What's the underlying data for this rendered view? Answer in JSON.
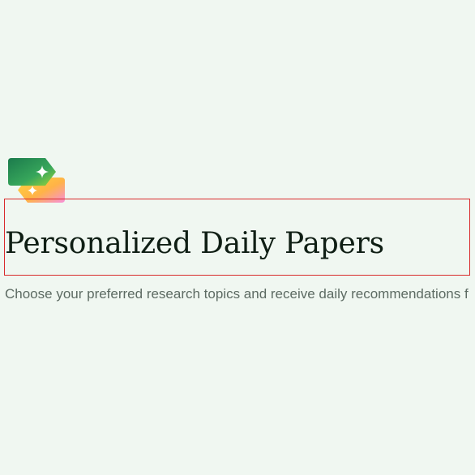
{
  "header": {
    "logo_icon": "sparkle-tags-icon",
    "title": "Personalized Daily Papers",
    "subtitle": "Choose your preferred research topics and receive daily recommendations f"
  },
  "colors": {
    "background": "#f0f7f1",
    "title": "#0f1e14",
    "subtitle": "#5d6b63",
    "highlight_border": "#d92b2b"
  }
}
